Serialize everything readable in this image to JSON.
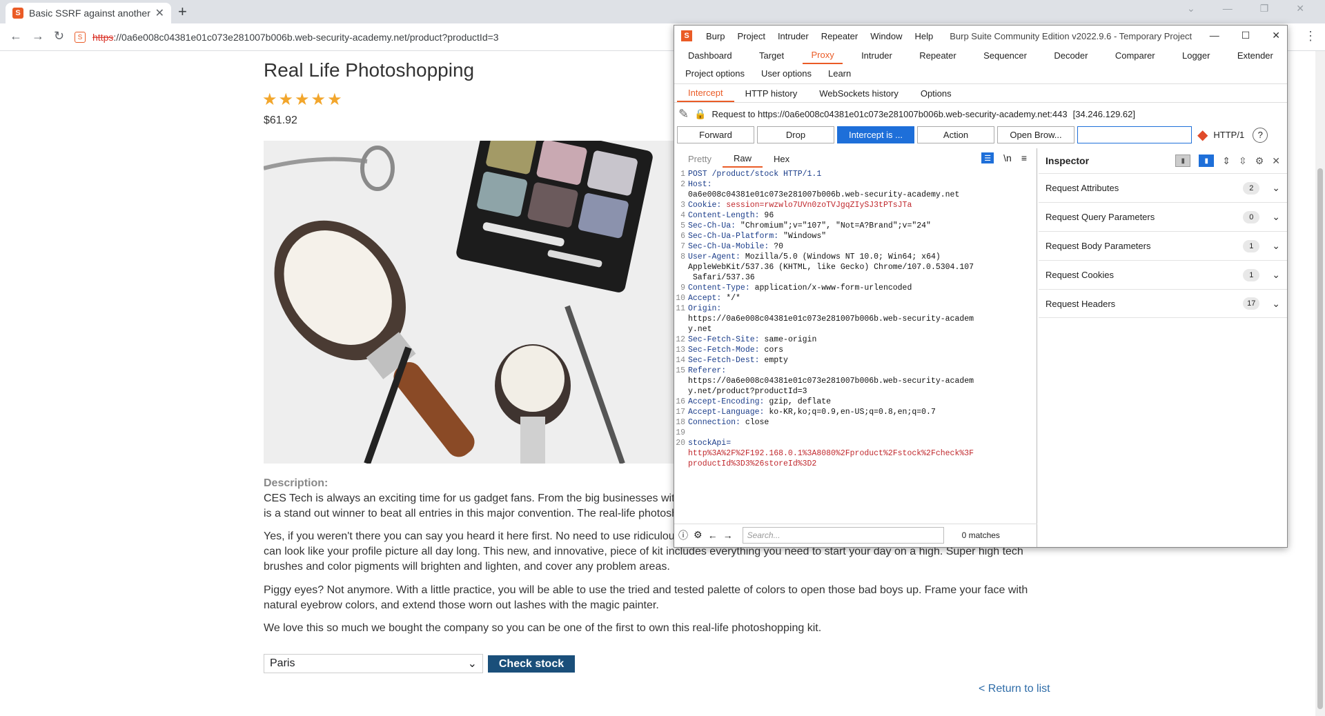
{
  "browser": {
    "tab_title": "Basic SSRF against another",
    "tab_favicon": "S",
    "new_tab": "+",
    "url_scheme": "https",
    "url_rest": "://0a6e008c04381e01c073e281007b006b.web-security-academy.net/product?productId=3"
  },
  "page": {
    "title": "Real Life Photoshopping",
    "stars": "★★★★★",
    "price": "$61.92",
    "description_label": "Description:",
    "paragraphs": [
      "CES Tech is always an exciting time for us gadget fans. From the big businesses wit",
      "is a stand out winner to beat all entries in this major convention. The real-life photosh",
      "Yes, if you weren't there you can say you heard it here first. No need to use ridiculou",
      "can look like your profile picture all day long. This new, and innovative, piece of kit includes everything you need to start your day on a high. Super high tech",
      "brushes and color pigments will brighten and lighten, and cover any problem areas.",
      "Piggy eyes? Not anymore. With a little practice, you will be able to use the tried and tested palette of colors to open those bad boys up. Frame your face with",
      "natural eyebrow colors, and extend those worn out lashes with the magic painter.",
      "We love this so much we bought the company so you can be one of the first to own this real-life photoshopping kit."
    ],
    "stock_location": "Paris",
    "check_stock_label": "Check stock",
    "return_label": "< Return to list"
  },
  "burp": {
    "logo": "S",
    "menu": [
      "Burp",
      "Project",
      "Intruder",
      "Repeater",
      "Window",
      "Help"
    ],
    "window_title": "Burp Suite Community Edition v2022.9.6 - Temporary Project",
    "main_tabs_row1": [
      "Dashboard",
      "Target",
      "Proxy",
      "Intruder",
      "Repeater",
      "Sequencer",
      "Decoder",
      "Comparer",
      "Logger",
      "Extender"
    ],
    "main_tabs_row2": [
      "Project options",
      "User options",
      "Learn"
    ],
    "selected_main_tab": "Proxy",
    "sub_tabs": [
      "Intercept",
      "HTTP history",
      "WebSockets history",
      "Options"
    ],
    "request_to": "Request to https://0a6e008c04381e01c073e281007b006b.web-security-academy.net:443",
    "request_ip": "[34.246.129.62]",
    "buttons": {
      "forward": "Forward",
      "drop": "Drop",
      "intercept": "Intercept is ...",
      "action": "Action",
      "open_browser": "Open Brow..."
    },
    "http_version": "HTTP/1",
    "editor_tabs": [
      "Pretty",
      "Raw",
      "Hex"
    ],
    "editor_selected": "Raw",
    "newline_toggle": "\\n",
    "request_lines": [
      {
        "n": "1",
        "k": "POST /product/stock HTTP/1.1",
        "v": "",
        "red": false
      },
      {
        "n": "2",
        "k": "Host:",
        "v": "",
        "red": false
      },
      {
        "n": "",
        "k": "",
        "v": "0a6e008c04381e01c073e281007b006b.web-security-academy.net",
        "red": false
      },
      {
        "n": "3",
        "k": "Cookie:",
        "v": " session=rwzwlo7UVn0zoTVJgqZIySJ3tPTsJTa",
        "red": true
      },
      {
        "n": "4",
        "k": "Content-Length:",
        "v": " 96",
        "red": false
      },
      {
        "n": "5",
        "k": "Sec-Ch-Ua:",
        "v": " \"Chromium\";v=\"107\", \"Not=A?Brand\";v=\"24\"",
        "red": false
      },
      {
        "n": "6",
        "k": "Sec-Ch-Ua-Platform:",
        "v": " \"Windows\"",
        "red": false
      },
      {
        "n": "7",
        "k": "Sec-Ch-Ua-Mobile:",
        "v": " ?0",
        "red": false
      },
      {
        "n": "8",
        "k": "User-Agent:",
        "v": " Mozilla/5.0 (Windows NT 10.0; Win64; x64)",
        "red": false
      },
      {
        "n": "",
        "k": "",
        "v": "AppleWebKit/537.36 (KHTML, like Gecko) Chrome/107.0.5304.107",
        "red": false
      },
      {
        "n": "",
        "k": "",
        "v": " Safari/537.36",
        "red": false
      },
      {
        "n": "9",
        "k": "Content-Type:",
        "v": " application/x-www-form-urlencoded",
        "red": false
      },
      {
        "n": "10",
        "k": "Accept:",
        "v": " */*",
        "red": false
      },
      {
        "n": "11",
        "k": "Origin:",
        "v": "",
        "red": false
      },
      {
        "n": "",
        "k": "",
        "v": "https://0a6e008c04381e01c073e281007b006b.web-security-academ",
        "red": false
      },
      {
        "n": "",
        "k": "",
        "v": "y.net",
        "red": false
      },
      {
        "n": "12",
        "k": "Sec-Fetch-Site:",
        "v": " same-origin",
        "red": false
      },
      {
        "n": "13",
        "k": "Sec-Fetch-Mode:",
        "v": " cors",
        "red": false
      },
      {
        "n": "14",
        "k": "Sec-Fetch-Dest:",
        "v": " empty",
        "red": false
      },
      {
        "n": "15",
        "k": "Referer:",
        "v": "",
        "red": false
      },
      {
        "n": "",
        "k": "",
        "v": "https://0a6e008c04381e01c073e281007b006b.web-security-academ",
        "red": false
      },
      {
        "n": "",
        "k": "",
        "v": "y.net/product?productId=3",
        "red": false
      },
      {
        "n": "16",
        "k": "Accept-Encoding:",
        "v": " gzip, deflate",
        "red": false
      },
      {
        "n": "17",
        "k": "Accept-Language:",
        "v": " ko-KR,ko;q=0.9,en-US;q=0.8,en;q=0.7",
        "red": false
      },
      {
        "n": "18",
        "k": "Connection:",
        "v": " close",
        "red": false
      },
      {
        "n": "19",
        "k": "",
        "v": "",
        "red": false
      },
      {
        "n": "20",
        "k": "stockApi=",
        "v": "",
        "red": false
      },
      {
        "n": "",
        "k": "",
        "v": "http%3A%2F%2F192.168.0.1%3A8080%2Fproduct%2Fstock%2Fcheck%3F",
        "red": true
      },
      {
        "n": "",
        "k": "",
        "v": "productId%3D3%26storeId%3D2",
        "red": true
      }
    ],
    "search_placeholder": "Search...",
    "matches": "0 matches",
    "inspector": {
      "title": "Inspector",
      "rows": [
        {
          "label": "Request Attributes",
          "count": "2"
        },
        {
          "label": "Request Query Parameters",
          "count": "0"
        },
        {
          "label": "Request Body Parameters",
          "count": "1"
        },
        {
          "label": "Request Cookies",
          "count": "1"
        },
        {
          "label": "Request Headers",
          "count": "17"
        }
      ]
    }
  }
}
